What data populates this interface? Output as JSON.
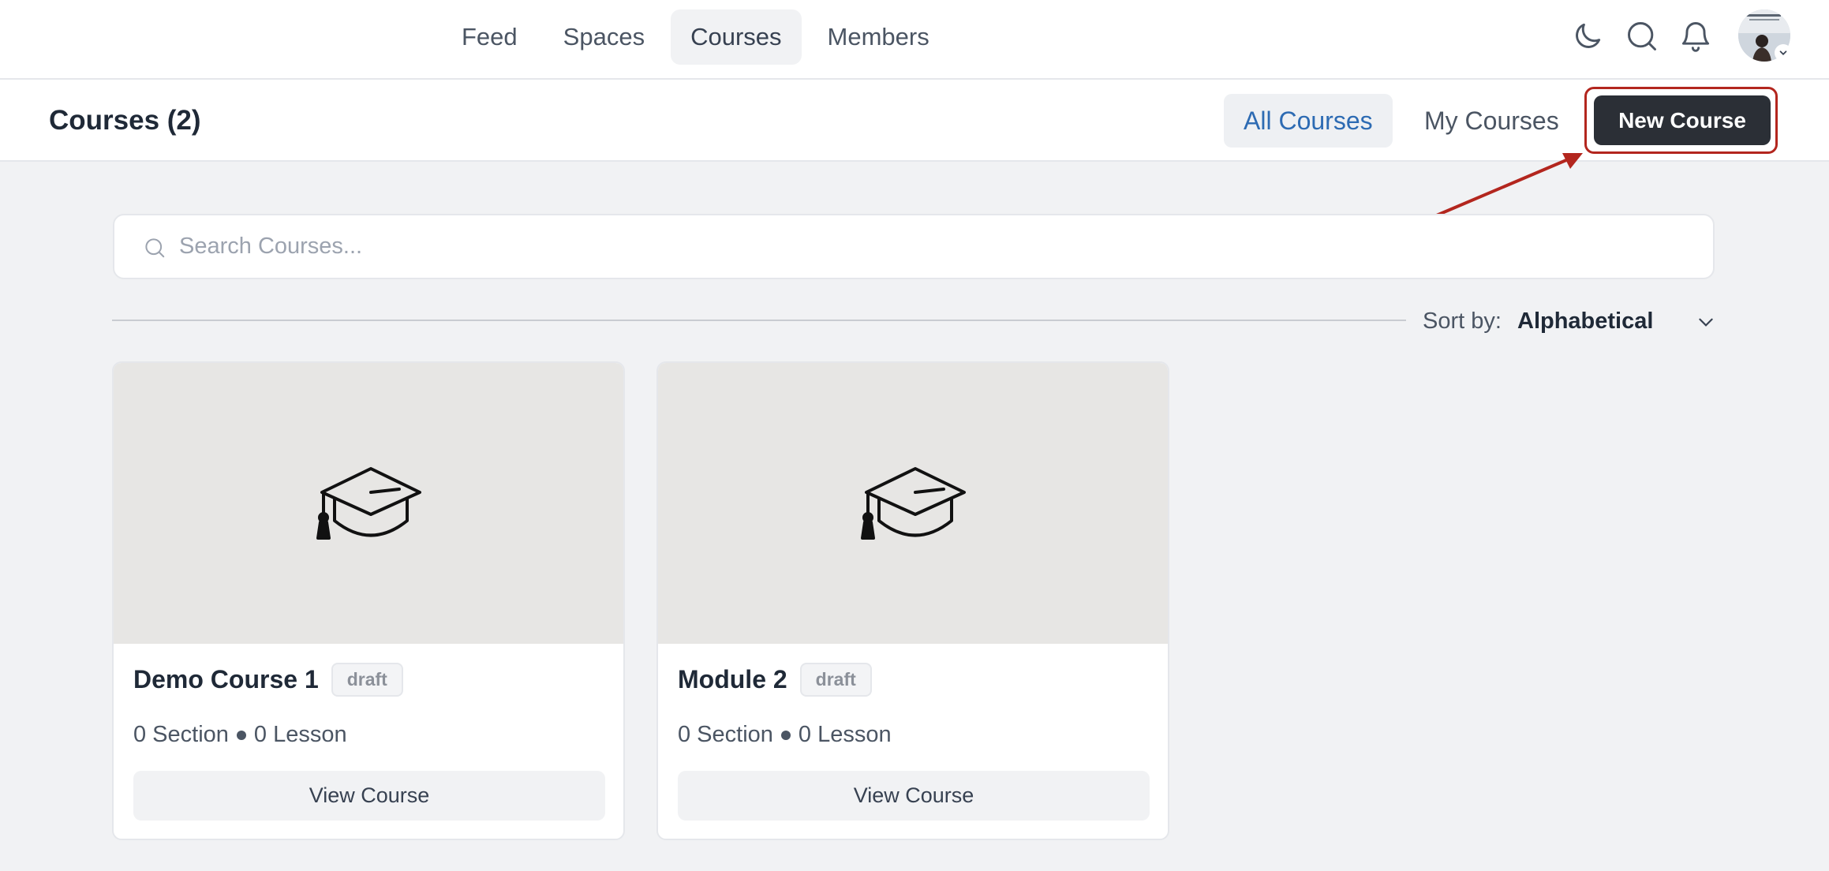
{
  "nav": {
    "items": [
      {
        "label": "Feed",
        "active": false
      },
      {
        "label": "Spaces",
        "active": false
      },
      {
        "label": "Courses",
        "active": true
      },
      {
        "label": "Members",
        "active": false
      }
    ],
    "icons": [
      "moon-icon",
      "search-icon",
      "bell-icon"
    ],
    "avatar": "user-avatar"
  },
  "header": {
    "title": "Courses (2)",
    "filters": [
      "All Courses",
      "My Courses"
    ],
    "active_filter": "All Courses",
    "new_course_label": "New Course"
  },
  "search": {
    "placeholder": "Search Courses...",
    "value": ""
  },
  "sort": {
    "label": "Sort by:",
    "value": "Alphabetical"
  },
  "courses": [
    {
      "title": "Demo Course 1",
      "status": "draft",
      "sections": "0 Section",
      "lessons": "0 Lesson",
      "action": "View Course"
    },
    {
      "title": "Module 2",
      "status": "draft",
      "sections": "0 Section",
      "lessons": "0 Lesson",
      "action": "View Course"
    }
  ],
  "colors": {
    "accent": "#2d6bb3",
    "primary_button": "#2b2f36",
    "annotation": "#b3261e",
    "page_bg": "#f1f2f4"
  }
}
